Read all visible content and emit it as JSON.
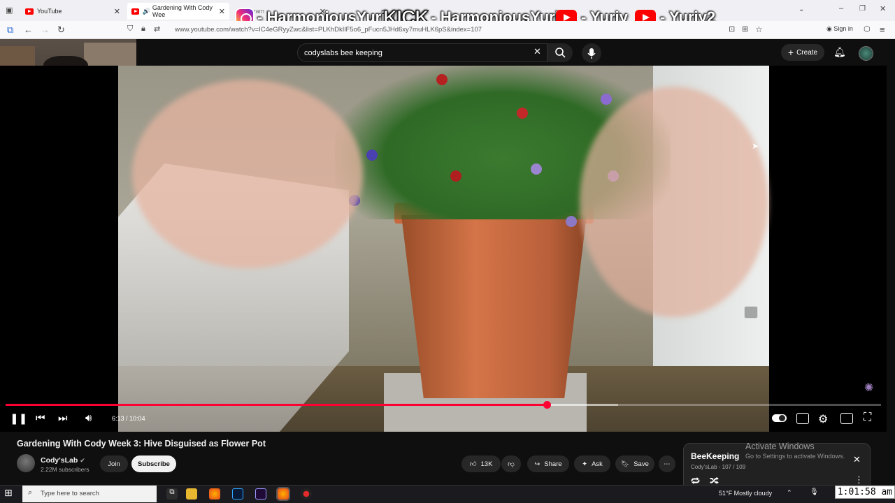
{
  "browser": {
    "tabs": [
      {
        "label": "YouTube"
      },
      {
        "label": "Gardening With Cody Wee"
      },
      {
        "label": "Instagram"
      }
    ],
    "url": "www.youtube.com/watch?v=IC4eGRyyZwc&list=PLKhDkIlF5o6_pFucn5JHd6xy7muHLK6pS&index=107",
    "sign_in": "Sign in"
  },
  "stream_overlay": {
    "instagram": "- HarmoniousYuriy",
    "kick_logo": "KICK",
    "kick": "- HarmoniousYuriy",
    "youtube1": "- Yuriy",
    "youtube2": "- Yuriy2"
  },
  "youtube": {
    "search_value": "codyslabs bee keeping",
    "create_label": "Create",
    "video": {
      "time_current": "6:13",
      "time_separator": " / ",
      "time_total": "10:04",
      "progress_fraction": 0.618,
      "buffer_fraction": 0.7
    },
    "title": "Gardening With Cody Week 3: Hive Disguised as Flower Pot",
    "channel": {
      "name": "Cody'sLab",
      "subscribers": "2.22M subscribers"
    },
    "buttons": {
      "join": "Join",
      "subscribe": "Subscribe",
      "likes": "13K",
      "share": "Share",
      "ask": "Ask",
      "save": "Save"
    },
    "playlist": {
      "title": "BeeKeeping",
      "subtitle": "Cody'sLab - 107 / 109"
    }
  },
  "windows": {
    "activate_title": "Activate Windows",
    "activate_sub": "Go to Settings to activate Windows.",
    "search_placeholder": "Type here to search",
    "weather": "51°F  Mostly cloudy",
    "clock": "1:01:58 am"
  },
  "colors": {
    "yt_red": "#ff0033",
    "bg": "#0f0f0f"
  }
}
